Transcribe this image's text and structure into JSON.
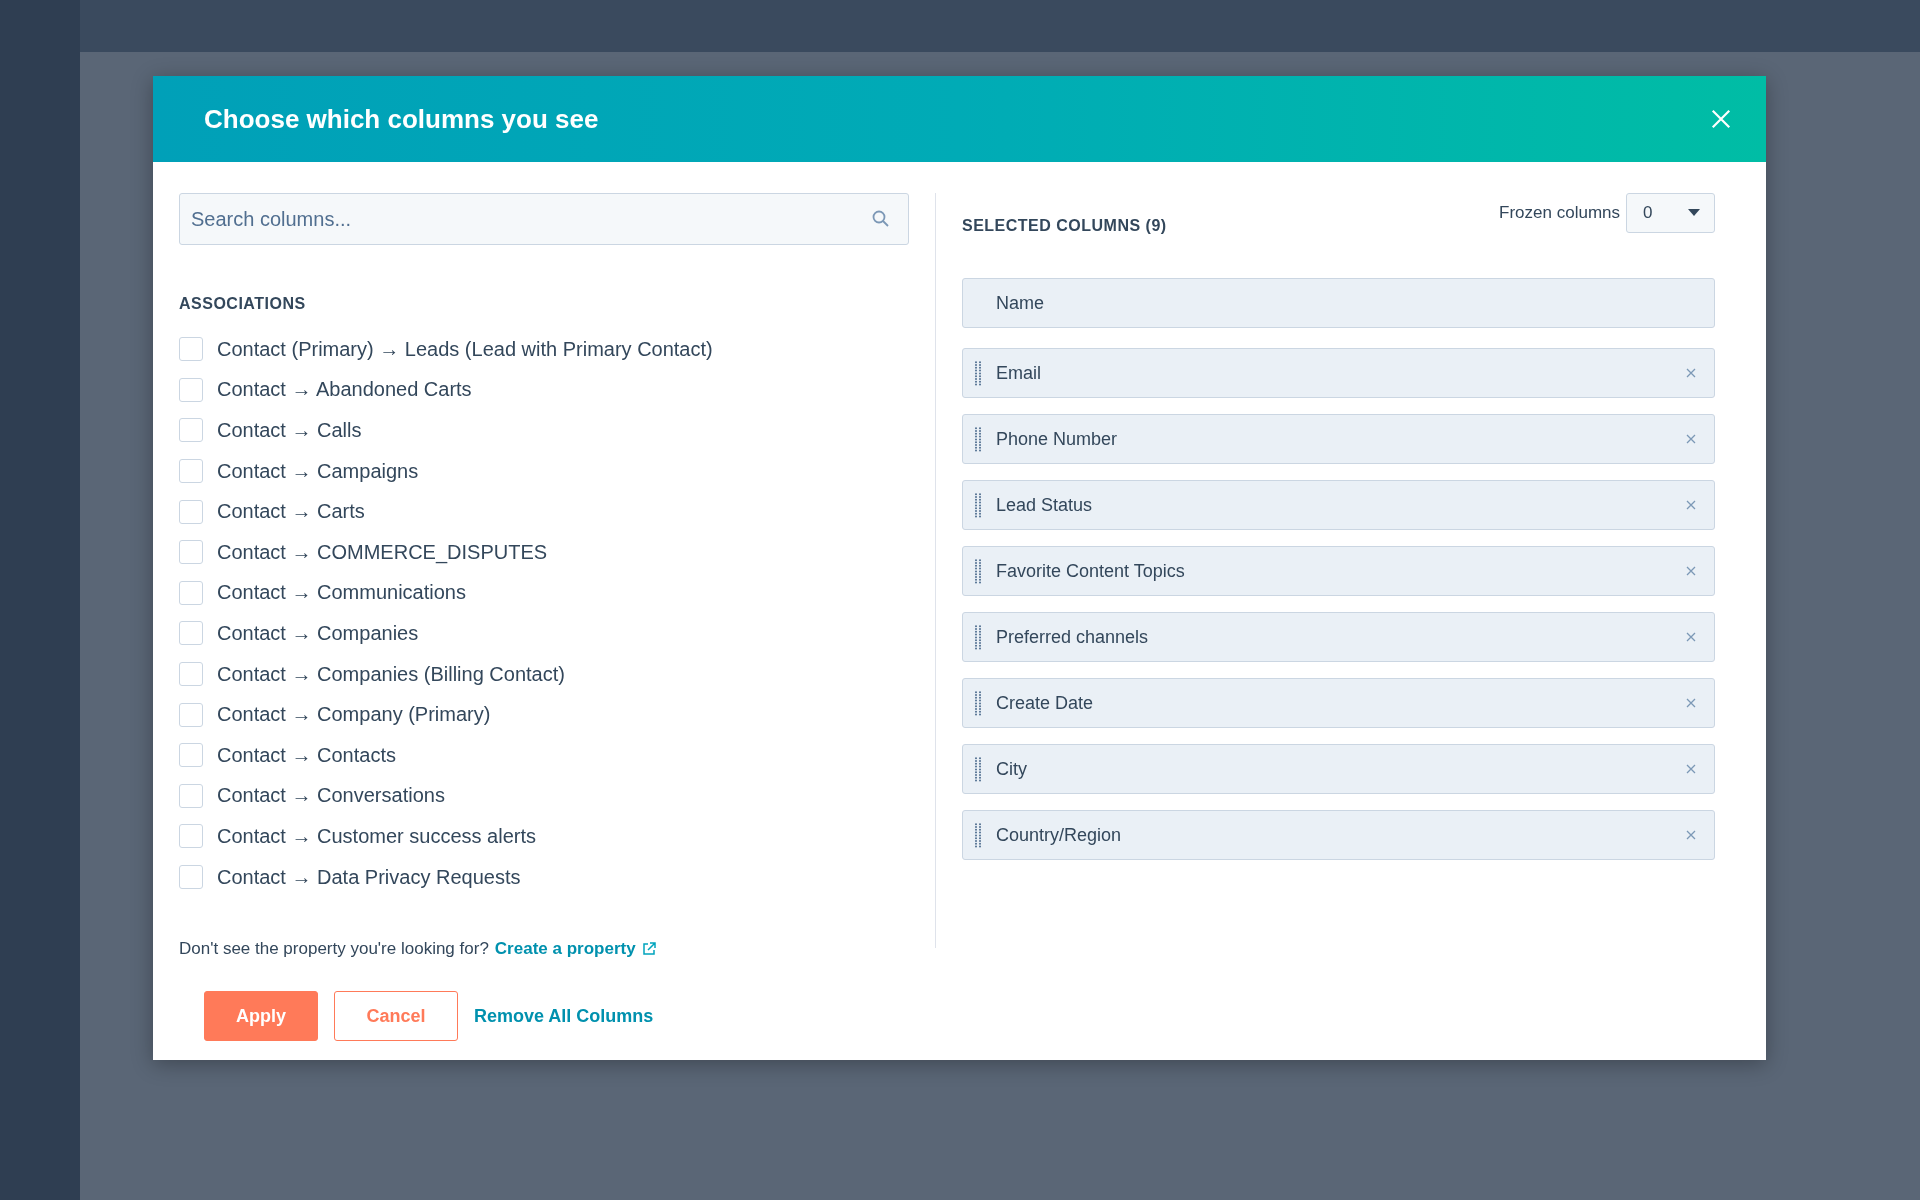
{
  "dialog": {
    "title": "Choose which columns you see"
  },
  "search": {
    "placeholder": "Search columns..."
  },
  "section": {
    "heading": "ASSOCIATIONS"
  },
  "options": [
    {
      "label": "Contact (Primary) → Leads (Lead with Primary Contact)",
      "checked": false
    },
    {
      "label": "Contact → Abandoned Carts",
      "checked": false
    },
    {
      "label": "Contact → Calls",
      "checked": false
    },
    {
      "label": "Contact → Campaigns",
      "checked": false
    },
    {
      "label": "Contact → Carts",
      "checked": false
    },
    {
      "label": "Contact → COMMERCE_DISPUTES",
      "checked": false
    },
    {
      "label": "Contact → Communications",
      "checked": false
    },
    {
      "label": "Contact → Companies",
      "checked": false
    },
    {
      "label": "Contact → Companies (Billing Contact)",
      "checked": false
    },
    {
      "label": "Contact → Company (Primary)",
      "checked": false
    },
    {
      "label": "Contact → Contacts",
      "checked": false
    },
    {
      "label": "Contact → Conversations",
      "checked": false
    },
    {
      "label": "Contact → Customer success alerts",
      "checked": false
    },
    {
      "label": "Contact → Data Privacy Requests",
      "checked": false
    }
  ],
  "footnote": {
    "text": "Don't see the property you're looking for?",
    "link": "Create a property"
  },
  "selected": {
    "heading": "SELECTED COLUMNS (9)",
    "frozen_label": "Frozen columns",
    "frozen_value": "0",
    "columns": [
      {
        "label": "Name",
        "kind": "locked"
      },
      {
        "label": "Email",
        "kind": "movable"
      },
      {
        "label": "Phone Number",
        "kind": "movable"
      },
      {
        "label": "Lead Status",
        "kind": "movable"
      },
      {
        "label": "Favorite Content Topics",
        "kind": "movable"
      },
      {
        "label": "Preferred channels",
        "kind": "movable"
      },
      {
        "label": "Create Date",
        "kind": "movable"
      },
      {
        "label": "City",
        "kind": "movable"
      },
      {
        "label": "Country/Region",
        "kind": "movable"
      }
    ]
  },
  "buttons": {
    "apply": "Apply",
    "cancel": "Cancel",
    "remove_all": "Remove All Columns"
  }
}
